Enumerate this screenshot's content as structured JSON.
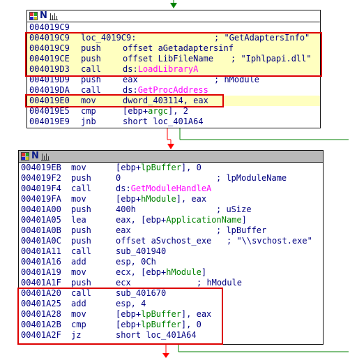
{
  "colors": {
    "highlight": "#ffffc0",
    "annotation_box": "#dd0000",
    "api_name": "#ff00ff",
    "stack_var": "#008000",
    "text": "#000080",
    "edge_true": "#008000",
    "edge_false": "#ff0000"
  },
  "blocks": [
    {
      "title_icons": [
        "graph-view-icon",
        "names-icon",
        "bars-icon"
      ],
      "lines": [
        {
          "addr": "004019C9",
          "mn": "",
          "op": "",
          "cm": "",
          "hl": false
        },
        {
          "addr": "004019C9",
          "mn": "loc_4019C9:",
          "op": "",
          "cm": "; \"GetAdaptersInfo\"",
          "hl": true
        },
        {
          "addr": "004019C9",
          "mn": "push",
          "op": "offset aGetadaptersinf",
          "cm": "",
          "hl": true
        },
        {
          "addr": "004019CE",
          "mn": "push",
          "op": "offset LibFileName",
          "cm": "; \"Iphlpapi.dll\"",
          "hl": true
        },
        {
          "addr": "004019D3",
          "mn": "call",
          "op": "ds:",
          "api": "LoadLibraryA",
          "cm": "",
          "hl": true
        },
        {
          "addr": "004019D9",
          "mn": "push",
          "op": "eax",
          "cm": "; hModule",
          "hl": false
        },
        {
          "addr": "004019DA",
          "mn": "call",
          "op": "ds:",
          "api": "GetProcAddress",
          "cm": "",
          "hl": false
        },
        {
          "addr": "004019E0",
          "mn": "mov",
          "op": "dword_403114, eax",
          "cm": "",
          "hl": true
        },
        {
          "addr": "004019E5",
          "mn": "cmp",
          "op": "[ebp+",
          "var": "argc",
          "op2": "], 2",
          "cm": "",
          "hl": false
        },
        {
          "addr": "004019E9",
          "mn": "jnb",
          "op": "short loc_401A64",
          "cm": "",
          "hl": false
        }
      ]
    },
    {
      "title_icons": [
        "graph-view-icon",
        "names-icon",
        "bars-icon"
      ],
      "lines": [
        {
          "addr": "004019EB",
          "mn": "mov",
          "op": "[ebp+",
          "var": "lpBuffer",
          "op2": "], 0",
          "cm": "",
          "hl": false
        },
        {
          "addr": "004019F2",
          "mn": "push",
          "op": "0",
          "cm": "; lpModuleName",
          "hl": false
        },
        {
          "addr": "004019F4",
          "mn": "call",
          "op": "ds:",
          "api": "GetModuleHandleA",
          "cm": "",
          "hl": false
        },
        {
          "addr": "004019FA",
          "mn": "mov",
          "op": "[ebp+",
          "var": "hModule",
          "op2": "], eax",
          "cm": "",
          "hl": false
        },
        {
          "addr": "00401A00",
          "mn": "push",
          "op": "400h",
          "cm": "; uSize",
          "hl": false
        },
        {
          "addr": "00401A05",
          "mn": "lea",
          "op": "eax, [ebp+",
          "var": "ApplicationName",
          "op2": "]",
          "cm": "",
          "hl": false
        },
        {
          "addr": "00401A0B",
          "mn": "push",
          "op": "eax",
          "cm": "; lpBuffer",
          "hl": false
        },
        {
          "addr": "00401A0C",
          "mn": "push",
          "op": "offset aSvchost_exe",
          "cm": "; \"\\\\svchost.exe\"",
          "hl": false
        },
        {
          "addr": "00401A11",
          "mn": "call",
          "op": "sub_401940",
          "cm": "",
          "hl": false
        },
        {
          "addr": "00401A16",
          "mn": "add",
          "op": "esp, 0Ch",
          "cm": "",
          "hl": false
        },
        {
          "addr": "00401A19",
          "mn": "mov",
          "op": "ecx, [ebp+",
          "var": "hModule",
          "op2": "]",
          "cm": "",
          "hl": false
        },
        {
          "addr": "00401A1F",
          "mn": "push",
          "op": "ecx",
          "cm": "; hModule",
          "hl": false
        },
        {
          "addr": "00401A20",
          "mn": "call",
          "op": "sub_401670",
          "cm": "",
          "hl": false
        },
        {
          "addr": "00401A25",
          "mn": "add",
          "op": "esp, 4",
          "cm": "",
          "hl": false
        },
        {
          "addr": "00401A28",
          "mn": "mov",
          "op": "[ebp+",
          "var": "lpBuffer",
          "op2": "], eax",
          "cm": "",
          "hl": false
        },
        {
          "addr": "00401A2B",
          "mn": "cmp",
          "op": "[ebp+",
          "var": "lpBuffer",
          "op2": "], 0",
          "cm": "",
          "hl": false
        },
        {
          "addr": "00401A2F",
          "mn": "jz",
          "op": "short loc_401A64",
          "cm": "",
          "hl": false
        }
      ]
    }
  ]
}
